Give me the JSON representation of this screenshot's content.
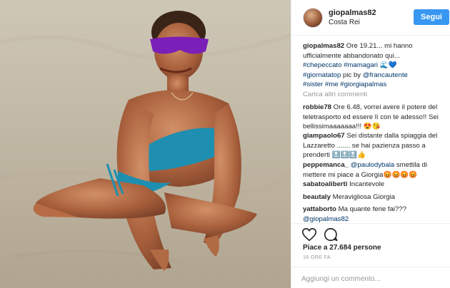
{
  "header": {
    "username": "giopalmas82",
    "location": "Costa Rei",
    "follow_label": "Segui"
  },
  "caption": {
    "user": "giopalmas82",
    "text": "Ore 19.21... mi hanno ufficialmente abbandonato qui...",
    "tags_line1": "#chepeccato #mamagari 🌊💙",
    "tags_line2": "#giornatatop",
    "tags_line2_mid": " pic by ",
    "mention": "@francautente",
    "tags_line3": "#sister #me #giorgiapalmas"
  },
  "load_more": "Carica altri commenti",
  "comments": [
    {
      "user": "robbie78",
      "text": "Ore 6.48, vorrei avere il potere del teletrasporto ed essere lì con te adesso!! Sei bellissimaaaaaaa!!! 😍😘"
    },
    {
      "user": "giampaolo67",
      "text": "Sei distante dalla spiaggia del Lazzaretto ....... se hai pazienza passo a prenderti 🔝🔝🔝👍"
    },
    {
      "user": "peppemanca_",
      "mention": "@paulodybala",
      "text": " smettila di mettere mi piace a Giorgia😡😡😡😡"
    },
    {
      "user": "sabatoaliberti",
      "text": "Incantevole"
    },
    {
      "user": "beautaly",
      "text": "Meravigliosa Giorgia"
    },
    {
      "user": "yattaborto",
      "text": "Ma quante ferie fai???",
      "mention_after": "@giopalmas82"
    }
  ],
  "actions": {
    "heart_icon": "heart-outline",
    "comment_icon": "speech-bubble-outline",
    "likes": "Piace a 27.684 persone",
    "time": "16 ORE FA",
    "add_comment_placeholder": "Aggiungi un commento..."
  },
  "colors": {
    "follow_blue": "#3897f0",
    "link_navy": "#003569",
    "glasses_purple": "#7a1fb8",
    "bikini_blue": "#1e8fb0",
    "sand": "#bdb4a2"
  }
}
